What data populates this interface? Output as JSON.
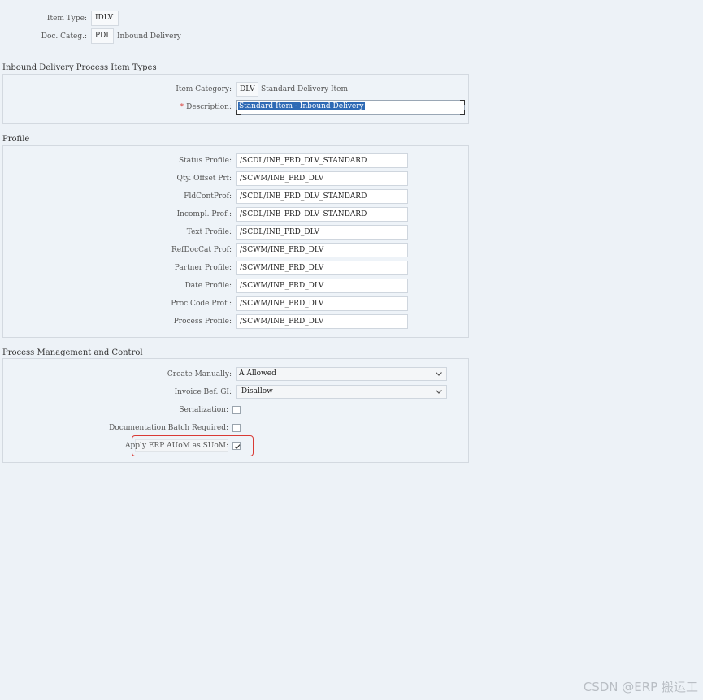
{
  "header": {
    "item_type_label": "Item Type:",
    "item_type_value": "IDLV",
    "doc_categ_label": "Doc. Categ.:",
    "doc_categ_value": "PDI",
    "doc_categ_text": "Inbound Delivery"
  },
  "section_item_types": {
    "title": "Inbound Delivery Process Item Types",
    "item_category_label": "Item Category:",
    "item_category_value": "DLV",
    "item_category_text": "Standard Delivery Item",
    "description_required": "*",
    "description_label": "Description:",
    "description_value": "Standard Item - Inbound Delivery"
  },
  "section_profile": {
    "title": "Profile",
    "rows": [
      {
        "label": "Status Profile:",
        "value": "/SCDL/INB_PRD_DLV_STANDARD"
      },
      {
        "label": "Qty. Offset Prf:",
        "value": "/SCWM/INB_PRD_DLV"
      },
      {
        "label": "FldContProf:",
        "value": "/SCDL/INB_PRD_DLV_STANDARD"
      },
      {
        "label": "Incompl. Prof.:",
        "value": "/SCDL/INB_PRD_DLV_STANDARD"
      },
      {
        "label": "Text Profile:",
        "value": "/SCDL/INB_PRD_DLV"
      },
      {
        "label": "RefDocCat Prof:",
        "value": "/SCWM/INB_PRD_DLV"
      },
      {
        "label": "Partner Profile:",
        "value": "/SCWM/INB_PRD_DLV"
      },
      {
        "label": "Date Profile:",
        "value": "/SCWM/INB_PRD_DLV"
      },
      {
        "label": "Proc.Code Prof.:",
        "value": "/SCWM/INB_PRD_DLV"
      },
      {
        "label": "Process Profile:",
        "value": "/SCWM/INB_PRD_DLV"
      }
    ]
  },
  "section_process": {
    "title": "Process Management and Control",
    "create_manually_label": "Create Manually:",
    "create_manually_value": "A Allowed",
    "invoice_label": "Invoice Bef. GI:",
    "invoice_value": " Disallow",
    "serialization_label": "Serialization:",
    "serialization_checked": false,
    "doc_batch_label": "Documentation Batch Required:",
    "doc_batch_checked": false,
    "apply_erp_label": "Apply ERP AUoM as SUoM:",
    "apply_erp_checked": true
  },
  "watermark": "CSDN @ERP 搬运工",
  "colors": {
    "background": "#edf2f7",
    "selection": "#2e6ab5",
    "highlight": "#d93a35",
    "required": "#d9413b"
  }
}
